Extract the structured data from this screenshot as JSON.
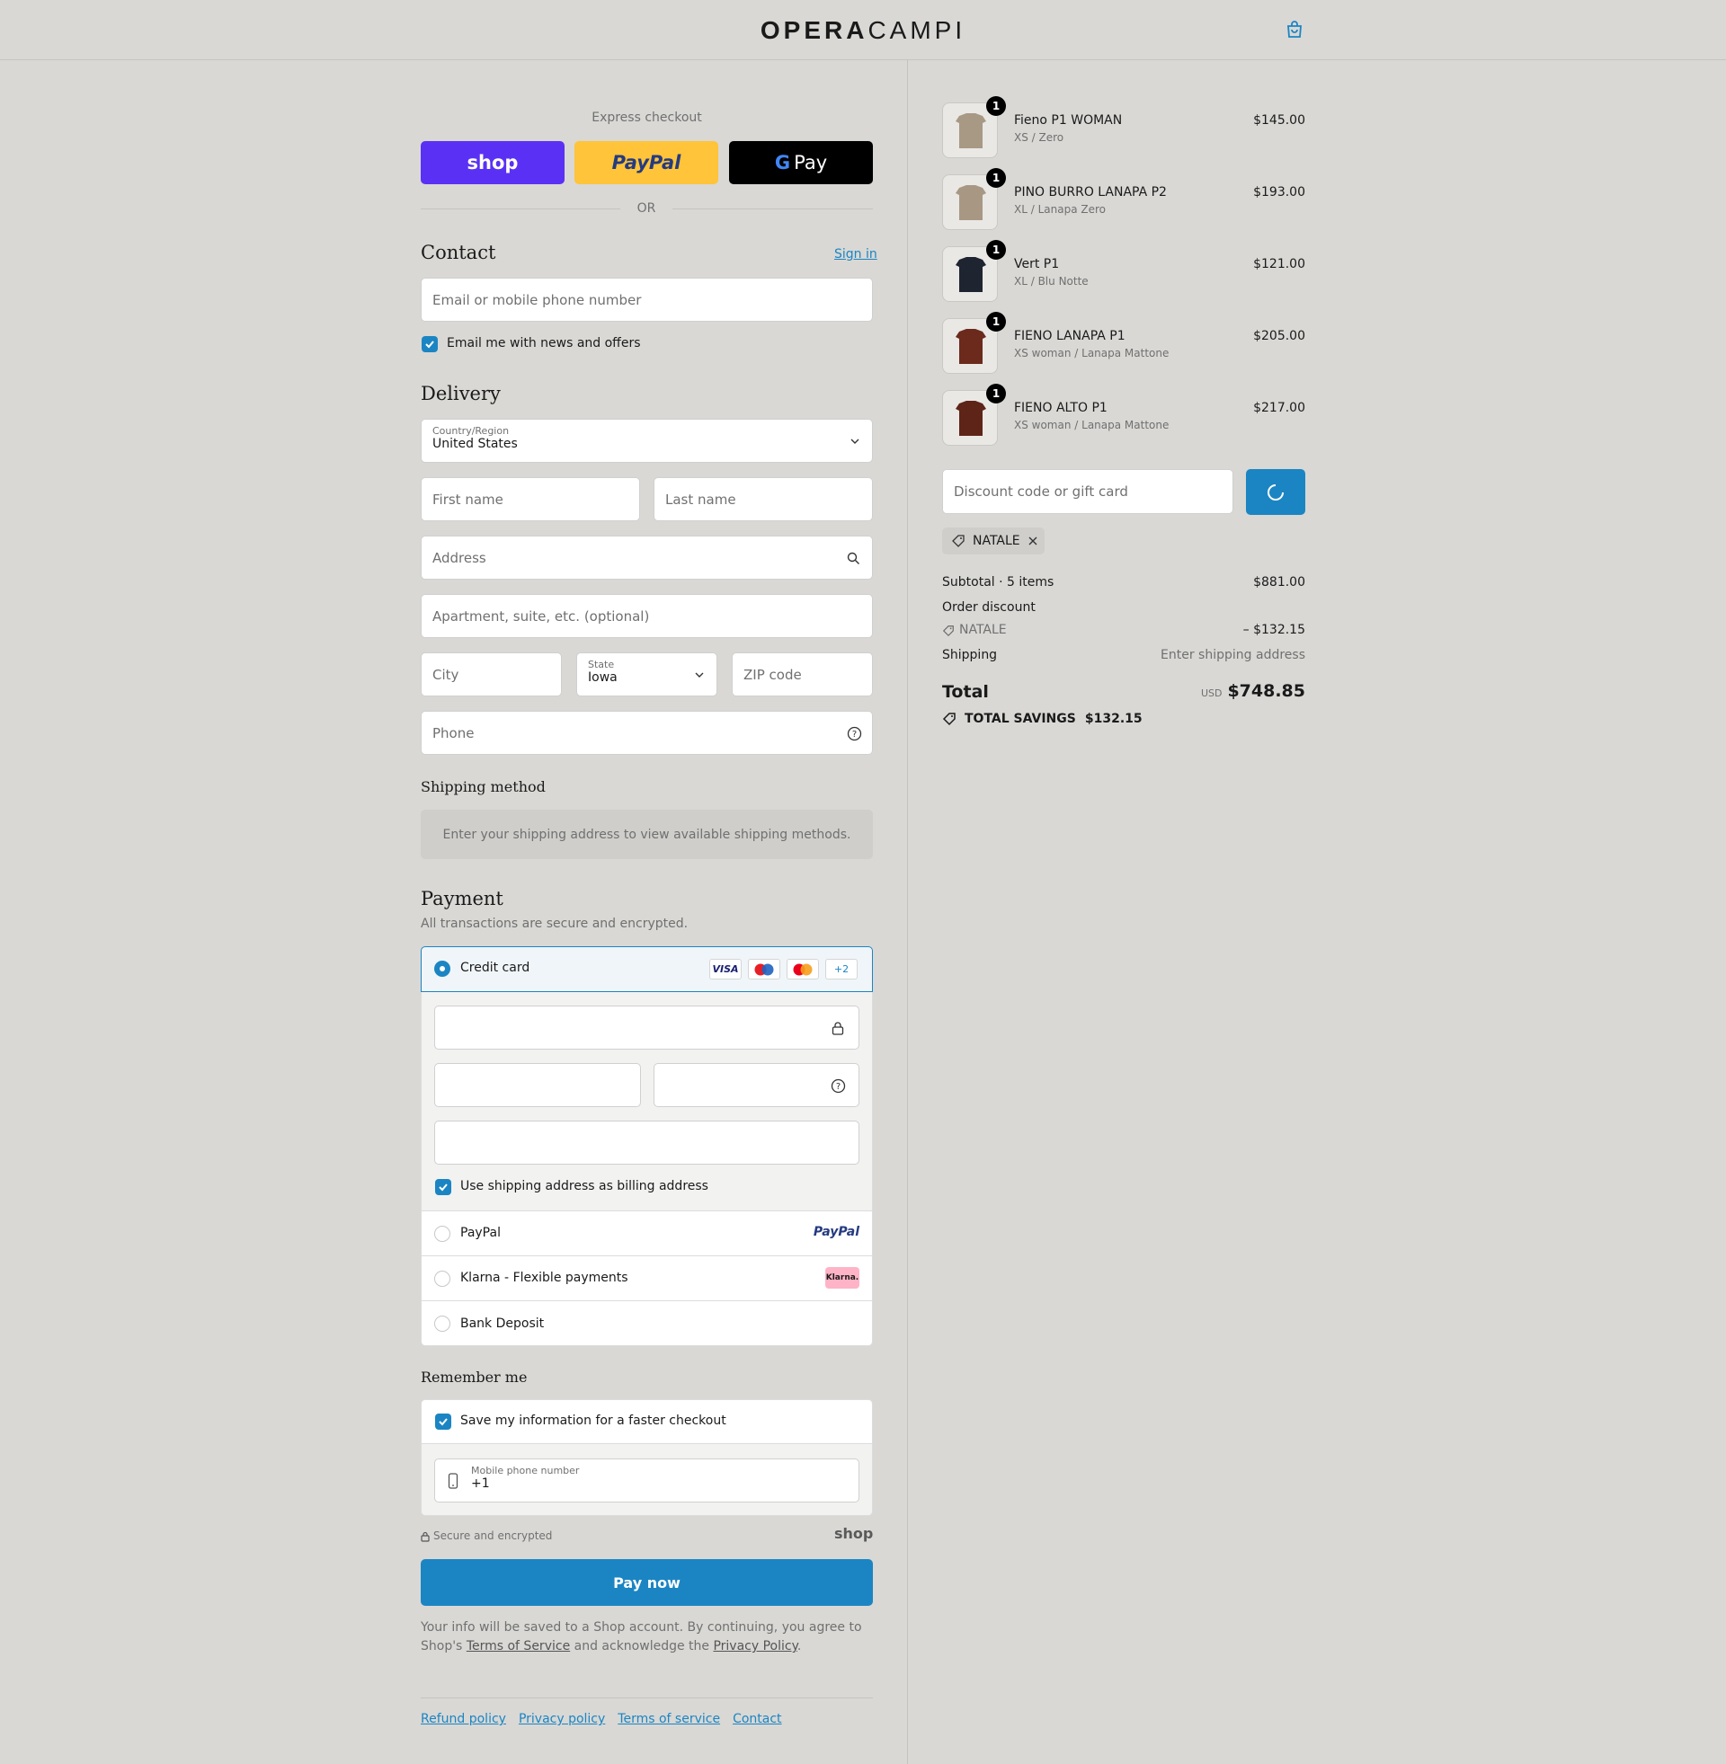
{
  "header": {
    "logo_bold": "OPERA",
    "logo_light": "CAMPI",
    "cart_icon": "bag-icon"
  },
  "express": {
    "title": "Express checkout",
    "shop_label": "shop",
    "paypal_label": "PayPal",
    "gpay_label": "Pay",
    "or": "OR"
  },
  "contact": {
    "title": "Contact",
    "sign_in": "Sign in",
    "email_placeholder": "Email or mobile phone number",
    "news_label": "Email me with news and offers"
  },
  "delivery": {
    "title": "Delivery",
    "country_label": "Country/Region",
    "country_value": "United States",
    "first_name": "First name",
    "last_name": "Last name",
    "address": "Address",
    "apartment": "Apartment, suite, etc. (optional)",
    "city": "City",
    "state_label": "State",
    "state_value": "Iowa",
    "zip": "ZIP code",
    "phone": "Phone"
  },
  "shipping_method": {
    "title": "Shipping method",
    "note": "Enter your shipping address to view available shipping methods."
  },
  "payment": {
    "title": "Payment",
    "subtitle": "All transactions are secure and encrypted.",
    "credit_card": "Credit card",
    "visa": "VISA",
    "more_cards": "+2",
    "billing_label": "Use shipping address as billing address",
    "paypal": "PayPal",
    "paypal_logo": "PayPal",
    "klarna": "Klarna - Flexible payments",
    "klarna_logo": "Klarna.",
    "bank": "Bank Deposit"
  },
  "remember": {
    "title": "Remember me",
    "save_label": "Save my information for a faster checkout",
    "mobile_label": "Mobile phone number",
    "mobile_value": "+1",
    "secure": "Secure and encrypted",
    "shop_logo": "shop"
  },
  "pay_now": "Pay now",
  "legal": {
    "line1": "Your info will be saved to a Shop account. By continuing, you agree to Shop's",
    "tos": "Terms of Service",
    "mid": " and acknowledge the ",
    "privacy": "Privacy Policy",
    "end": "."
  },
  "footer_links": [
    "Refund policy",
    "Privacy policy",
    "Terms of service",
    "Contact"
  ],
  "cart": {
    "items": [
      {
        "name": "Fieno P1 WOMAN",
        "variant": "XS / Zero",
        "price": "$145.00",
        "qty": "1",
        "color": "#a89985"
      },
      {
        "name": "PINO BURRO LANAPA P2",
        "variant": "XL / Lanapa Zero",
        "price": "$193.00",
        "qty": "1",
        "color": "#a89883"
      },
      {
        "name": "Vert P1",
        "variant": "XL / Blu Notte",
        "price": "$121.00",
        "qty": "1",
        "color": "#1e2430"
      },
      {
        "name": "FIENO LANAPA P1",
        "variant": "XS woman / Lanapa Mattone",
        "price": "$205.00",
        "qty": "1",
        "color": "#6b2a1c"
      },
      {
        "name": "FIENO ALTO P1",
        "variant": "XS woman / Lanapa Mattone",
        "price": "$217.00",
        "qty": "1",
        "color": "#5e2417"
      }
    ],
    "discount_placeholder": "Discount code or gift card",
    "applied_code": "NATALE",
    "subtotal_label": "Subtotal · 5 items",
    "subtotal_value": "$881.00",
    "order_discount": "Order discount",
    "discount_code": "NATALE",
    "discount_value": "– $132.15",
    "shipping_label": "Shipping",
    "shipping_value": "Enter shipping address",
    "total_label": "Total",
    "currency": "USD",
    "total_value": "$748.85",
    "savings_label": "TOTAL SAVINGS",
    "savings_value": "$132.15"
  },
  "colors": {
    "accent": "#1b85c3",
    "shop_purple": "#5a31f4",
    "paypal_yellow": "#ffc439"
  }
}
